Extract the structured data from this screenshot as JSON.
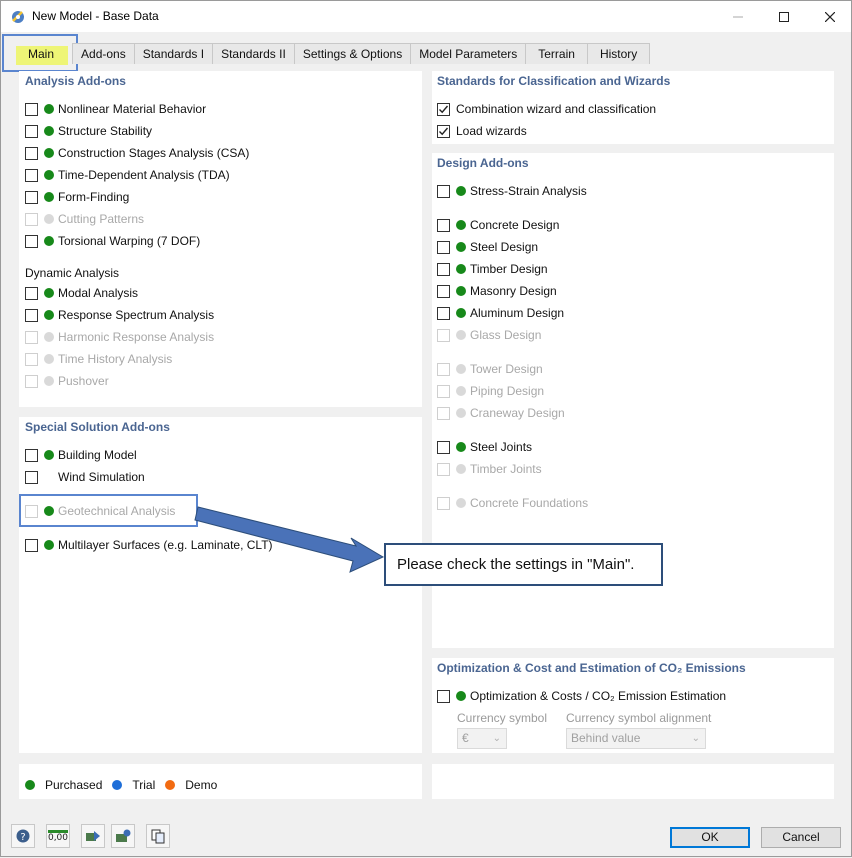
{
  "window": {
    "title": "New Model - Base Data"
  },
  "tabs": [
    "Main",
    "Add-ons",
    "Standards I",
    "Standards II",
    "Settings & Options",
    "Model Parameters",
    "Terrain",
    "History"
  ],
  "analysis": {
    "title": "Analysis Add-ons",
    "items": [
      {
        "label": "Nonlinear Material Behavior",
        "enabled": true
      },
      {
        "label": "Structure Stability",
        "enabled": true
      },
      {
        "label": "Construction Stages Analysis (CSA)",
        "enabled": true
      },
      {
        "label": "Time-Dependent Analysis (TDA)",
        "enabled": true
      },
      {
        "label": "Form-Finding",
        "enabled": true
      },
      {
        "label": "Cutting Patterns",
        "enabled": false
      },
      {
        "label": "Torsional Warping (7 DOF)",
        "enabled": true
      }
    ],
    "dynamic_title": "Dynamic Analysis",
    "dynamic_items": [
      {
        "label": "Modal Analysis",
        "enabled": true
      },
      {
        "label": "Response Spectrum Analysis",
        "enabled": true
      },
      {
        "label": "Harmonic Response Analysis",
        "enabled": false
      },
      {
        "label": "Time History Analysis",
        "enabled": false
      },
      {
        "label": "Pushover",
        "enabled": false
      }
    ]
  },
  "special": {
    "title": "Special Solution Add-ons",
    "items": [
      {
        "label": "Building Model",
        "enabled": true
      },
      {
        "label": "Wind Simulation",
        "enabled": true
      },
      {
        "label": "Geotechnical Analysis",
        "enabled": false
      },
      {
        "label": "Multilayer Surfaces (e.g. Laminate, CLT)",
        "enabled": true
      }
    ]
  },
  "standards": {
    "title": "Standards for Classification and Wizards",
    "items": [
      {
        "label": "Combination wizard and classification",
        "checked": true
      },
      {
        "label": "Load wizards",
        "checked": true
      }
    ]
  },
  "design": {
    "title": "Design Add-ons",
    "items": [
      {
        "label": "Stress-Strain Analysis",
        "enabled": true
      },
      {
        "label": "Concrete Design",
        "enabled": true
      },
      {
        "label": "Steel Design",
        "enabled": true
      },
      {
        "label": "Timber Design",
        "enabled": true
      },
      {
        "label": "Masonry Design",
        "enabled": true
      },
      {
        "label": "Aluminum Design",
        "enabled": true
      },
      {
        "label": "Glass Design",
        "enabled": false
      },
      {
        "label": "Tower Design",
        "enabled": false
      },
      {
        "label": "Piping Design",
        "enabled": false
      },
      {
        "label": "Craneway Design",
        "enabled": false
      },
      {
        "label": "Steel Joints",
        "enabled": true
      },
      {
        "label": "Timber Joints",
        "enabled": false
      },
      {
        "label": "Concrete Foundations",
        "enabled": false
      }
    ]
  },
  "optimization": {
    "title": "Optimization & Cost and Estimation of CO₂ Emissions",
    "item_label": "Optimization & Costs / CO₂ Emission Estimation",
    "currency_label": "Currency symbol",
    "currency_value": "€",
    "alignment_label": "Currency symbol alignment",
    "alignment_value": "Behind value"
  },
  "legend": {
    "purchased": "Purchased",
    "trial": "Trial",
    "demo": "Demo"
  },
  "callout": "Please check the settings in \"Main\".",
  "buttons": {
    "ok": "OK",
    "cancel": "Cancel"
  },
  "toolbar": {
    "units_text": "0,00"
  },
  "colors": {
    "purchased": "#17891a",
    "trial": "#1e6ed8",
    "demo": "#f26b12",
    "section_title": "#4a6591",
    "highlight": "#5a85cf",
    "tab_highlight": "#eef576"
  }
}
